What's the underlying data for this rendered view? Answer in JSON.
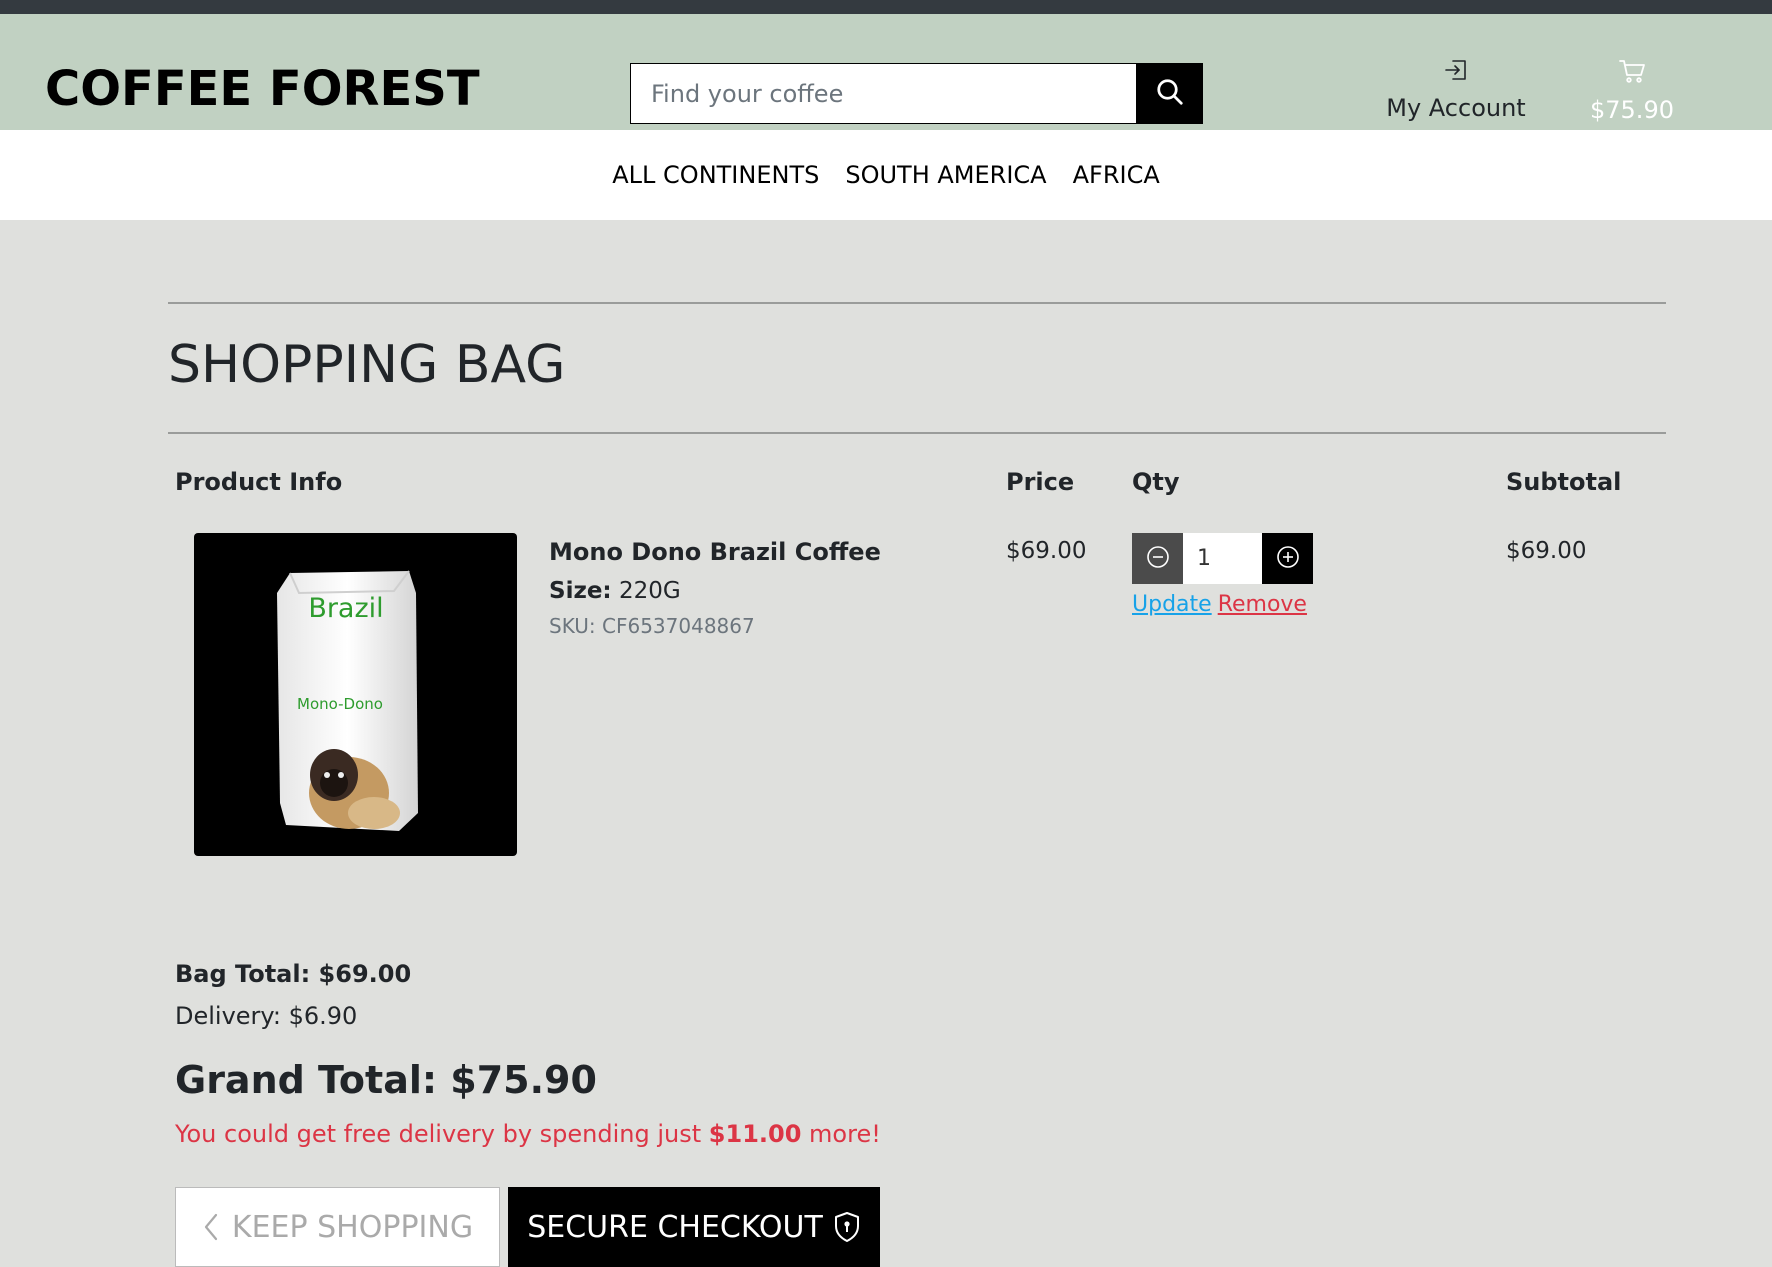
{
  "header": {
    "logo": "COFFEE FOREST",
    "search_placeholder": "Find your coffee",
    "account_label": "My Account",
    "bag_total": "$75.90"
  },
  "nav": {
    "items": [
      "ALL CONTINENTS",
      "SOUTH AMERICA",
      "AFRICA"
    ]
  },
  "bag": {
    "title": "SHOPPING BAG",
    "columns": {
      "product": "Product Info",
      "price": "Price",
      "qty": "Qty",
      "subtotal": "Subtotal"
    },
    "item": {
      "name": "Mono Dono Brazil Coffee",
      "size_label": "Size:",
      "size": "220G",
      "sku": "SKU: CF6537048867",
      "price": "$69.00",
      "quantity": "1",
      "update_label": "Update",
      "remove_label": "Remove",
      "subtotal": "$69.00",
      "image_text_top": "Brazil",
      "image_text_mid": "Mono-Dono"
    },
    "bag_total": "Bag Total: $69.00",
    "delivery": "Delivery: $6.90",
    "grand_total": "Grand Total: $75.90",
    "free_delivery_prefix": "You could get free delivery by spending just ",
    "free_delivery_amount": "$11.00",
    "free_delivery_suffix": " more!",
    "keep_shopping": "KEEP SHOPPING",
    "secure_checkout": "SECURE CHECKOUT"
  },
  "colors": {
    "header_bg": "#c1d1c2",
    "page_bg": "#dfe0dd",
    "accent_danger": "#dc3545",
    "link": "#17a2e8"
  }
}
